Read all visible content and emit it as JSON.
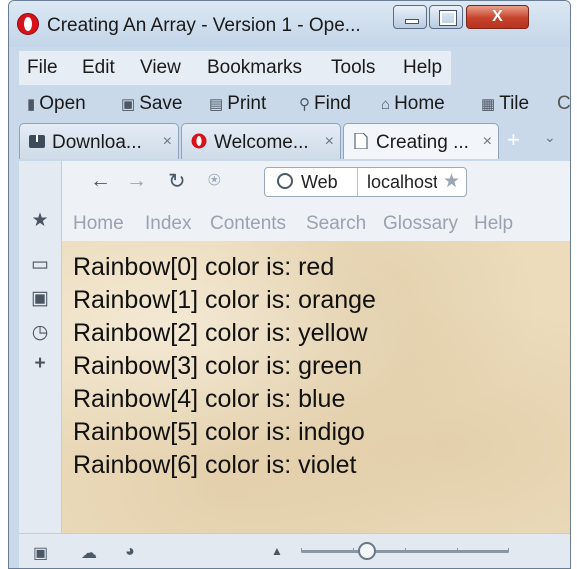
{
  "window": {
    "title": "Creating An Array - Version 1 - Ope...",
    "close_glyph": "X"
  },
  "menu": [
    "File",
    "Edit",
    "View",
    "Bookmarks",
    "Tools",
    "Help"
  ],
  "toolbar": {
    "items": [
      "Open",
      "Save",
      "Print",
      "Find",
      "Home",
      "Tile"
    ],
    "overflow": "C"
  },
  "tabs": [
    {
      "label": "Downloa...",
      "icon": "downloads-icon",
      "close": "×"
    },
    {
      "label": "Welcome...",
      "icon": "opera-icon",
      "close": "×"
    },
    {
      "label": "Creating ...",
      "icon": "page-icon",
      "close": "×"
    }
  ],
  "newtab": "+",
  "address": {
    "web_label": "Web",
    "url": "localhost"
  },
  "links": [
    "Home",
    "Index",
    "Contents",
    "Search",
    "Glossary",
    "Help"
  ],
  "content": {
    "lines": [
      "Rainbow[0] color is: red",
      "Rainbow[1] color is: orange",
      "Rainbow[2] color is: yellow",
      "Rainbow[3] color is: green",
      "Rainbow[4] color is: blue",
      "Rainbow[5] color is: indigo",
      "Rainbow[6] color is: violet"
    ]
  },
  "colors": {
    "page_bg": "#ecdcbc",
    "chrome": "#c9d9ea",
    "close_button": "#c7412b"
  }
}
